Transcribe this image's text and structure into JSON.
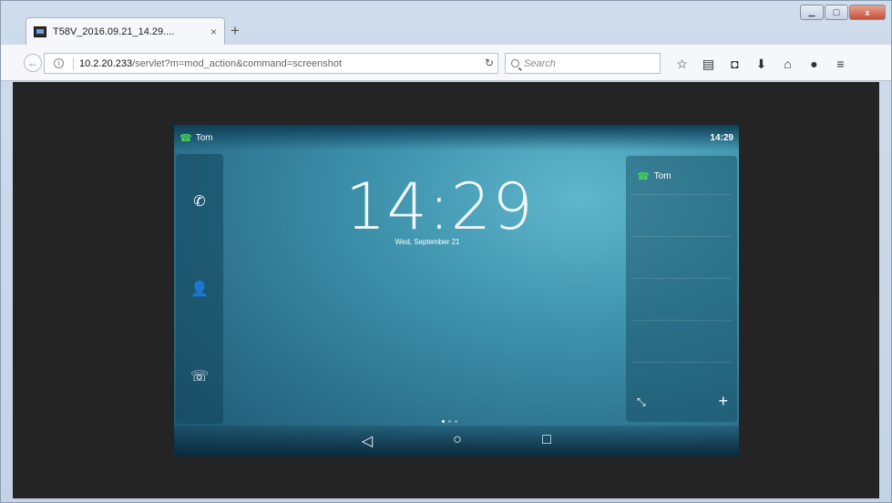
{
  "browser": {
    "tab_title": "T58V_2016.09.21_14.29....",
    "tab_close": "×",
    "new_tab": "+",
    "url_host": "10.2.20.233",
    "url_path": "/servlet?m=mod_action&command=screenshot",
    "search_placeholder": "Search",
    "toolbar_icons": [
      "star-icon",
      "clipboard-icon",
      "pocket-icon",
      "download-icon",
      "home-icon",
      "chat-icon",
      "menu-icon"
    ],
    "win_close": "x"
  },
  "phone": {
    "status_contact": "Tom",
    "status_time": "14:29",
    "clock": "14:29",
    "date": "Wed, September 21",
    "dock": [
      "phone-icon",
      "contacts-icon",
      "call-history-icon"
    ],
    "right_panel_contact": "Tom",
    "page_dots": 3,
    "active_dot": 0,
    "nav": [
      "back-icon",
      "home-icon",
      "recents-icon"
    ]
  },
  "colors": {
    "accent_green": "#4bd35c",
    "background": "#242424",
    "screen_teal": "#3f93ad"
  }
}
